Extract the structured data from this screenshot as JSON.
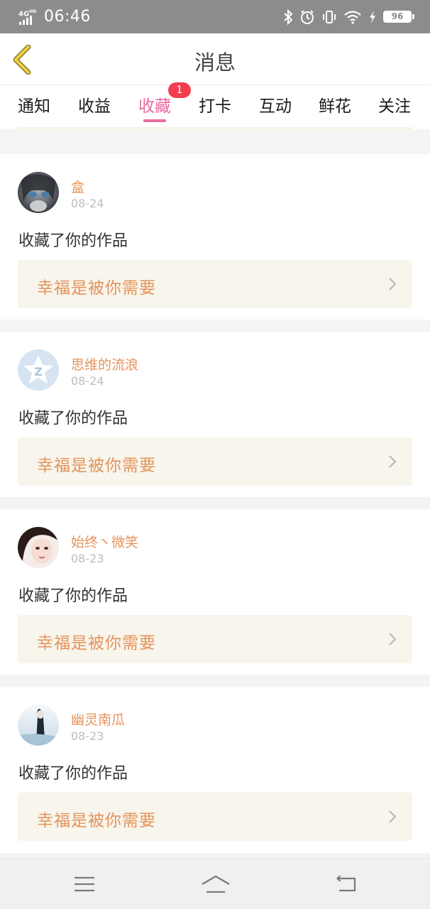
{
  "status_bar": {
    "network": "4G",
    "network_hd": "HD",
    "time": "06:46",
    "battery": "96",
    "icons": [
      "bluetooth-icon",
      "alarm-icon",
      "vibrate-icon",
      "wifi-icon",
      "charging-icon",
      "battery-icon"
    ]
  },
  "header": {
    "title": "消息",
    "back_icon": "chevron-left-icon",
    "back_color": "#e8c73a"
  },
  "tabs": [
    {
      "label": "通知"
    },
    {
      "label": "收益"
    },
    {
      "label": "收藏",
      "active": true,
      "badge": "1"
    },
    {
      "label": "打卡"
    },
    {
      "label": "互动"
    },
    {
      "label": "鲜花"
    },
    {
      "label": "关注"
    }
  ],
  "colors": {
    "accent": "#e86aa0",
    "name": "#e6935a",
    "badge": "#f23d4f",
    "work_box": "#f7f5ec"
  },
  "notifications": [
    {
      "user": "盒",
      "date": "08-24",
      "action": "收藏了你的作品",
      "work_title": "幸福是被你需要"
    },
    {
      "user": "思维的流浪",
      "date": "08-24",
      "action": "收藏了你的作品",
      "work_title": "幸福是被你需要"
    },
    {
      "user": "始终丶微笑",
      "date": "08-23",
      "action": "收藏了你的作品",
      "work_title": "幸福是被你需要"
    },
    {
      "user": "幽灵南瓜",
      "date": "08-23",
      "action": "收藏了你的作品",
      "work_title": "幸福是被你需要"
    }
  ],
  "bottom_nav": {
    "icons": [
      "menu-icon",
      "home-icon",
      "back-icon"
    ]
  }
}
